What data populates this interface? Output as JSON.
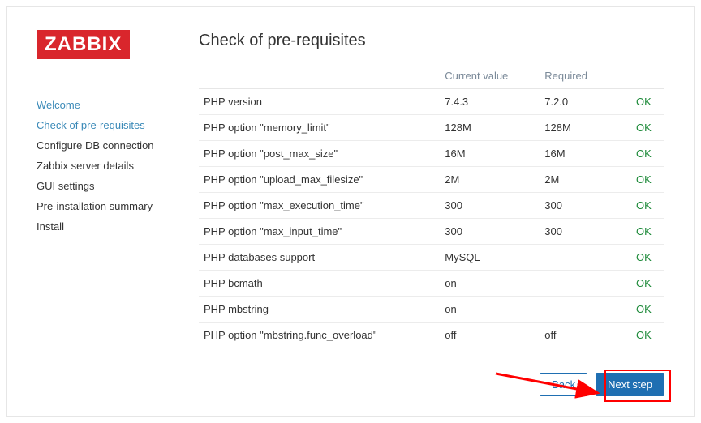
{
  "brand": "ZABBIX",
  "page_title": "Check of pre-requisites",
  "nav": {
    "items": [
      {
        "label": "Welcome",
        "state": "done"
      },
      {
        "label": "Check of pre-requisites",
        "state": "active"
      },
      {
        "label": "Configure DB connection",
        "state": ""
      },
      {
        "label": "Zabbix server details",
        "state": ""
      },
      {
        "label": "GUI settings",
        "state": ""
      },
      {
        "label": "Pre-installation summary",
        "state": ""
      },
      {
        "label": "Install",
        "state": ""
      }
    ]
  },
  "table": {
    "headers": {
      "name": "",
      "current": "Current value",
      "required": "Required",
      "status": ""
    },
    "rows": [
      {
        "name": "PHP version",
        "current": "7.4.3",
        "required": "7.2.0",
        "status": "OK"
      },
      {
        "name": "PHP option \"memory_limit\"",
        "current": "128M",
        "required": "128M",
        "status": "OK"
      },
      {
        "name": "PHP option \"post_max_size\"",
        "current": "16M",
        "required": "16M",
        "status": "OK"
      },
      {
        "name": "PHP option \"upload_max_filesize\"",
        "current": "2M",
        "required": "2M",
        "status": "OK"
      },
      {
        "name": "PHP option \"max_execution_time\"",
        "current": "300",
        "required": "300",
        "status": "OK"
      },
      {
        "name": "PHP option \"max_input_time\"",
        "current": "300",
        "required": "300",
        "status": "OK"
      },
      {
        "name": "PHP databases support",
        "current": "MySQL",
        "required": "",
        "status": "OK"
      },
      {
        "name": "PHP bcmath",
        "current": "on",
        "required": "",
        "status": "OK"
      },
      {
        "name": "PHP mbstring",
        "current": "on",
        "required": "",
        "status": "OK"
      },
      {
        "name": "PHP option \"mbstring.func_overload\"",
        "current": "off",
        "required": "off",
        "status": "OK"
      }
    ]
  },
  "buttons": {
    "back": "Back",
    "next": "Next step"
  },
  "colors": {
    "brand_bg": "#d9262c",
    "accent": "#1f6fb2",
    "ok": "#1f8b3b",
    "annot": "#ff0000"
  }
}
